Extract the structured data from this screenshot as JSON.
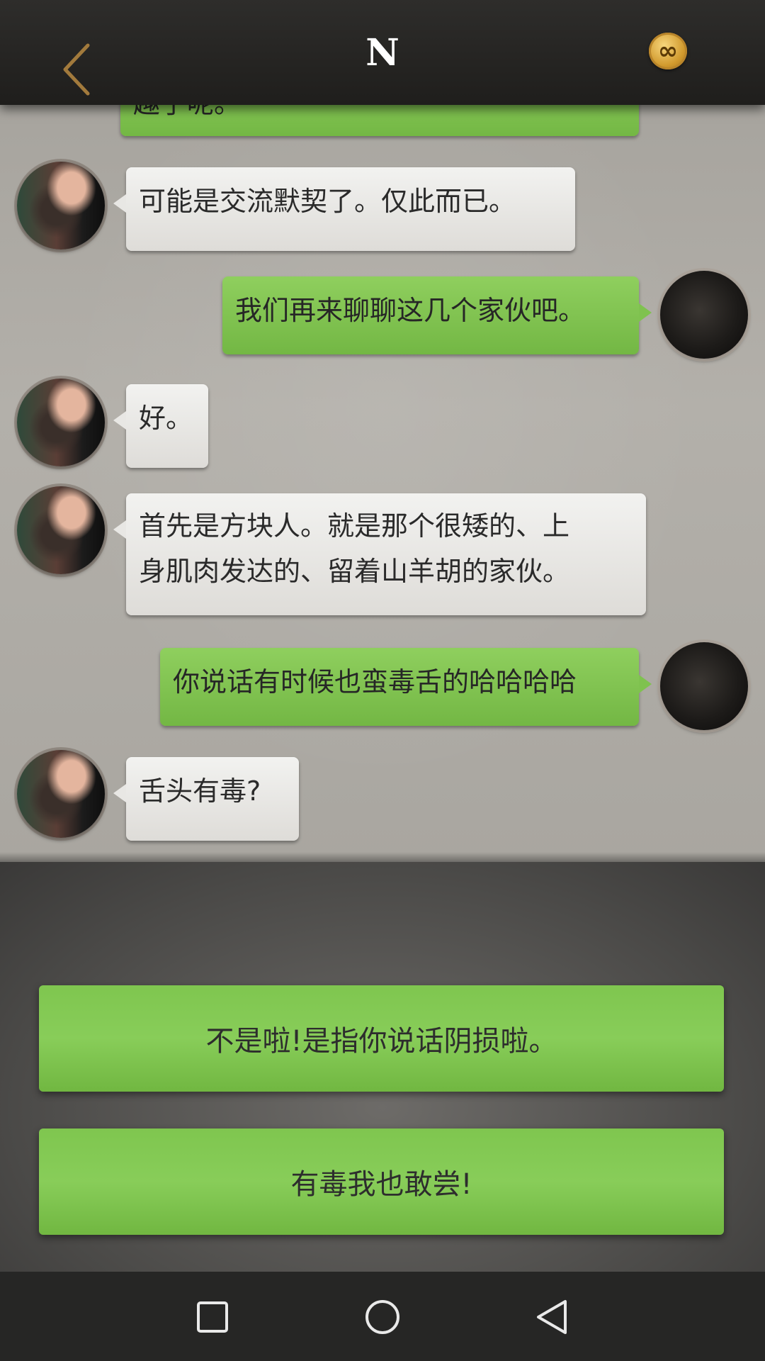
{
  "header": {
    "title": "N",
    "coin_symbol": "∞"
  },
  "chat": {
    "cut_message": "趣了呢。",
    "messages": [
      {
        "side": "left",
        "text": "可能是交流默契了。仅此而已。"
      },
      {
        "side": "right",
        "text": "我们再来聊聊这几个家伙吧。"
      },
      {
        "side": "left",
        "text": "好。"
      },
      {
        "side": "left",
        "lines": [
          "首先是方块人。就是那个很矮的、上",
          "身肌肉发达的、留着山羊胡的家伙。"
        ]
      },
      {
        "side": "right",
        "text": "你说话有时候也蛮毒舌的哈哈哈哈"
      },
      {
        "side": "left",
        "text": "舌头有毒?"
      }
    ]
  },
  "choices": [
    {
      "label": "不是啦!是指你说话阴损啦。"
    },
    {
      "label": "有毒我也敢尝!"
    }
  ],
  "colors": {
    "bubble_green": "#7fc24f",
    "bubble_white": "#eeeeec",
    "coin_gold": "#d19a2e",
    "back_arrow": "#a27a3c"
  }
}
